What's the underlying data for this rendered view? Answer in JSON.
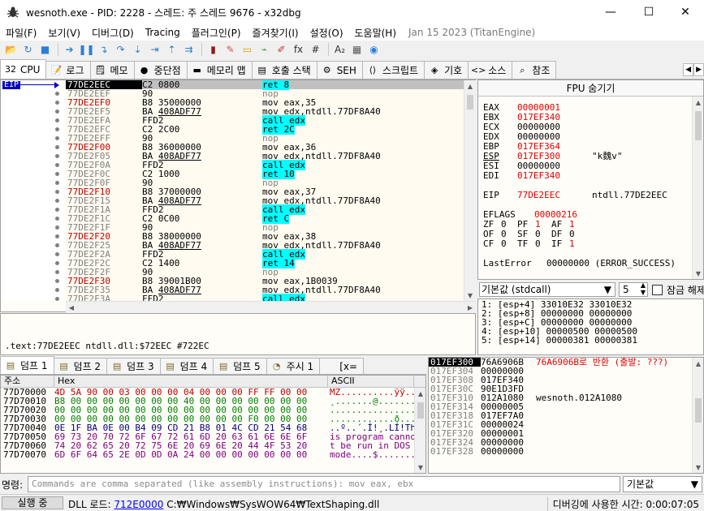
{
  "window": {
    "title": "wesnoth.exe - PID: 2228 - 스레드: 주 스레드 9676 - x32dbg",
    "minimize": "—",
    "maximize": "☐",
    "close": "✕"
  },
  "menu": {
    "items": [
      "파일(F)",
      "보기(V)",
      "디버그(D)",
      "Tracing",
      "플러그인(P)",
      "즐겨찾기(I)",
      "설정(O)",
      "도움말(H)"
    ],
    "build": "Jan 15 2023 (TitanEngine)"
  },
  "toolbar": {
    "buttons": [
      {
        "name": "open-icon",
        "glyph": "📂",
        "color": "#d4a017"
      },
      {
        "name": "restart-icon",
        "glyph": "↻",
        "color": "#2a7fd4"
      },
      {
        "name": "close-debug-icon",
        "glyph": "■",
        "color": "#2a7fd4"
      },
      {
        "name": "run-icon",
        "glyph": "➔",
        "color": "#2a7fd4"
      },
      {
        "name": "pause-icon",
        "glyph": "❚❚",
        "color": "#2a7fd4"
      },
      {
        "name": "step-into-icon",
        "glyph": "↴",
        "color": "#2a7fd4"
      },
      {
        "name": "step-over-icon",
        "glyph": "↷",
        "color": "#2a7fd4"
      },
      {
        "name": "trace-into-icon",
        "glyph": "⇣",
        "color": "#2a7fd4"
      },
      {
        "name": "trace-over-icon",
        "glyph": "⇥",
        "color": "#2a7fd4"
      },
      {
        "name": "execute-till-return-icon",
        "glyph": "⇡",
        "color": "#2a7fd4"
      },
      {
        "name": "run-to-user-code-icon",
        "glyph": "⇉",
        "color": "#2a7fd4"
      },
      {
        "name": "scylla-icon",
        "glyph": "▮",
        "color": "#8b1a1a"
      },
      {
        "name": "patch-icon",
        "glyph": "✎",
        "color": "#d9534f"
      },
      {
        "name": "comment-icon",
        "glyph": "▭",
        "color": "#d9a400"
      },
      {
        "name": "label-icon",
        "glyph": "⌁",
        "color": "#5a8f5a"
      },
      {
        "name": "bookmark-icon",
        "glyph": "✐",
        "color": "#c9302c"
      },
      {
        "name": "function-icon",
        "glyph": "fx",
        "color": "#333333"
      },
      {
        "name": "hash-icon",
        "glyph": "#",
        "color": "#333333"
      },
      {
        "name": "font-icon",
        "glyph": "A₂",
        "color": "#333333"
      },
      {
        "name": "memory-icon",
        "glyph": "▦",
        "color": "#5a5a5a"
      },
      {
        "name": "globe-icon",
        "glyph": "◉",
        "color": "#2a7fd4"
      }
    ]
  },
  "tabs": [
    {
      "name": "tab-cpu",
      "icon": "cpu-icon",
      "glyph": "32",
      "label": "CPU",
      "active": true
    },
    {
      "name": "tab-log",
      "icon": "log-icon",
      "glyph": "📝",
      "label": "로그"
    },
    {
      "name": "tab-notes",
      "icon": "notes-icon",
      "glyph": "🗒",
      "label": "메모"
    },
    {
      "name": "tab-breakpoints",
      "icon": "breakpoint-icon",
      "glyph": "●",
      "label": "중단점"
    },
    {
      "name": "tab-memory-map",
      "icon": "memory-map-icon",
      "glyph": "▬",
      "label": "메모리 맵"
    },
    {
      "name": "tab-call-stack",
      "icon": "call-stack-icon",
      "glyph": "▤",
      "label": "호출 스택"
    },
    {
      "name": "tab-seh",
      "icon": "seh-icon",
      "glyph": "⚙",
      "label": "SEH"
    },
    {
      "name": "tab-script",
      "icon": "script-icon",
      "glyph": "⟨⟩",
      "label": "스크립트"
    },
    {
      "name": "tab-symbols",
      "icon": "symbols-icon",
      "glyph": "◈",
      "label": "기호"
    },
    {
      "name": "tab-source",
      "icon": "source-icon",
      "glyph": "<>",
      "label": "소스"
    },
    {
      "name": "tab-references",
      "icon": "references-icon",
      "glyph": "⌕",
      "label": "참조"
    }
  ],
  "tabs_scroll": {
    "left": "◀",
    "right": "▶"
  },
  "disasm": {
    "eip_label": "EIP",
    "rows": [
      {
        "addr": "77DE2EEC",
        "bytes": "C2 0800",
        "instr": "ret 8",
        "kind": "ret",
        "red": false,
        "cur": true
      },
      {
        "addr": "77DE2EEF",
        "bytes": "90",
        "instr": "nop",
        "kind": "nop",
        "red": false
      },
      {
        "addr": "77DE2EF0",
        "bytes": "B8 35000000",
        "instr": "mov eax,35",
        "kind": "",
        "red": true
      },
      {
        "addr": "77DE2EF5",
        "bytes": "BA 408ADF77",
        "instr": "mov edx,ntdll.77DF8A40",
        "kind": "",
        "red": false,
        "ul": true
      },
      {
        "addr": "77DE2EFA",
        "bytes": "FFD2",
        "instr": "call edx",
        "kind": "call",
        "red": false
      },
      {
        "addr": "77DE2EFC",
        "bytes": "C2 2C00",
        "instr": "ret 2C",
        "kind": "ret",
        "red": false
      },
      {
        "addr": "77DE2EFF",
        "bytes": "90",
        "instr": "nop",
        "kind": "nop",
        "red": false
      },
      {
        "addr": "77DE2F00",
        "bytes": "B8 36000000",
        "instr": "mov eax,36",
        "kind": "",
        "red": true
      },
      {
        "addr": "77DE2F05",
        "bytes": "BA 408ADF77",
        "instr": "mov edx,ntdll.77DF8A40",
        "kind": "",
        "red": false,
        "ul": true
      },
      {
        "addr": "77DE2F0A",
        "bytes": "FFD2",
        "instr": "call edx",
        "kind": "call",
        "red": false
      },
      {
        "addr": "77DE2F0C",
        "bytes": "C2 1000",
        "instr": "ret 10",
        "kind": "ret",
        "red": false
      },
      {
        "addr": "77DE2F0F",
        "bytes": "90",
        "instr": "nop",
        "kind": "nop",
        "red": false
      },
      {
        "addr": "77DE2F10",
        "bytes": "B8 37000000",
        "instr": "mov eax,37",
        "kind": "",
        "red": true
      },
      {
        "addr": "77DE2F15",
        "bytes": "BA 408ADF77",
        "instr": "mov edx,ntdll.77DF8A40",
        "kind": "",
        "red": false,
        "ul": true
      },
      {
        "addr": "77DE2F1A",
        "bytes": "FFD2",
        "instr": "call edx",
        "kind": "call",
        "red": false
      },
      {
        "addr": "77DE2F1C",
        "bytes": "C2 0C00",
        "instr": "ret C",
        "kind": "ret",
        "red": false
      },
      {
        "addr": "77DE2F1F",
        "bytes": "90",
        "instr": "nop",
        "kind": "nop",
        "red": false
      },
      {
        "addr": "77DE2F20",
        "bytes": "B8 38000000",
        "instr": "mov eax,38",
        "kind": "",
        "red": true
      },
      {
        "addr": "77DE2F25",
        "bytes": "BA 408ADF77",
        "instr": "mov edx,ntdll.77DF8A40",
        "kind": "",
        "red": false,
        "ul": true
      },
      {
        "addr": "77DE2F2A",
        "bytes": "FFD2",
        "instr": "call edx",
        "kind": "call",
        "red": false
      },
      {
        "addr": "77DE2F2C",
        "bytes": "C2 1400",
        "instr": "ret 14",
        "kind": "ret",
        "red": false
      },
      {
        "addr": "77DE2F2F",
        "bytes": "90",
        "instr": "nop",
        "kind": "nop",
        "red": false
      },
      {
        "addr": "77DE2F30",
        "bytes": "B8 39001B00",
        "instr": "mov eax,1B0039",
        "kind": "",
        "red": true
      },
      {
        "addr": "77DE2F35",
        "bytes": "BA 408ADF77",
        "instr": "mov edx,ntdll.77DF8A40",
        "kind": "",
        "red": false,
        "ul": true
      },
      {
        "addr": "77DE2F3A",
        "bytes": "FFD2",
        "instr": "call edx",
        "kind": "call",
        "red": false
      }
    ]
  },
  "info": {
    "text": ".text:77DE2EEC ntdll.dll:$72EEC #722EC"
  },
  "registers": {
    "header": "FPU 숨기기",
    "rows": [
      {
        "name": "EAX",
        "value": "00000001",
        "red": true,
        "comment": ""
      },
      {
        "name": "EBX",
        "value": "017EF340",
        "red": true,
        "comment": ""
      },
      {
        "name": "ECX",
        "value": "00000000",
        "red": false,
        "comment": ""
      },
      {
        "name": "EDX",
        "value": "00000000",
        "red": false,
        "comment": ""
      },
      {
        "name": "EBP",
        "value": "017EF364",
        "red": true,
        "comment": ""
      },
      {
        "name": "ESP",
        "value": "017EF300",
        "red": true,
        "comment": "\"k魏v\"",
        "ul": true
      },
      {
        "name": "ESI",
        "value": "00000000",
        "red": false,
        "comment": ""
      },
      {
        "name": "EDI",
        "value": "017EF340",
        "red": true,
        "comment": ""
      }
    ],
    "eip": {
      "name": "EIP",
      "value": "77DE2EEC",
      "comment": "ntdll.77DE2EEC"
    },
    "eflags": {
      "name": "EFLAGS",
      "value": "00000216"
    },
    "flags": [
      [
        {
          "n": "ZF",
          "v": "0",
          "red": false
        },
        {
          "n": "PF",
          "v": "1",
          "red": true
        },
        {
          "n": "AF",
          "v": "1",
          "red": true
        }
      ],
      [
        {
          "n": "OF",
          "v": "0",
          "red": false
        },
        {
          "n": "SF",
          "v": "0",
          "red": false
        },
        {
          "n": "DF",
          "v": "0",
          "red": false
        }
      ],
      [
        {
          "n": "CF",
          "v": "0",
          "red": false
        },
        {
          "n": "TF",
          "v": "0",
          "red": false
        },
        {
          "n": "IF",
          "v": "1",
          "red": true
        }
      ]
    ],
    "lasterror": {
      "name": "LastError",
      "value": "00000000 (ERROR_SUCCESS)"
    }
  },
  "args": {
    "convention": "기본값 (stdcall)",
    "count": "5",
    "checkbox_label": "잠금 해제",
    "rows": [
      "1: [esp+4]  33010E32 33010E32",
      "2: [esp+8]  00000000 00000000",
      "3: [esp+C]  00000000 00000000",
      "4: [esp+10] 00000500 00000500",
      "5: [esp+14] 00000381 00000381"
    ]
  },
  "dump_tabs": [
    {
      "name": "tab-dump-1",
      "label": "덤프 1",
      "active": true
    },
    {
      "name": "tab-dump-2",
      "label": "덤프 2"
    },
    {
      "name": "tab-dump-3",
      "label": "덤프 3"
    },
    {
      "name": "tab-dump-4",
      "label": "덤프 4"
    },
    {
      "name": "tab-dump-5",
      "label": "덤프 5"
    },
    {
      "name": "tab-watch-1",
      "label": "주시 1"
    },
    {
      "name": "tab-locals",
      "label": "[x="
    }
  ],
  "dump": {
    "col_addr": "주소",
    "col_hex": "Hex",
    "col_ascii": "ASCII",
    "rows": [
      {
        "addr": "77D70000",
        "hex": "4D 5A 90 00 03 00 00 00 04 00 00 00 FF FF 00 00",
        "ascii": "MZ..........ÿÿ..",
        "c": "r"
      },
      {
        "addr": "77D70010",
        "hex": "B8 00 00 00 00 00 00 00 40 00 00 00 00 00 00 00",
        "ascii": "¸.......@.......",
        "c": "g"
      },
      {
        "addr": "77D70020",
        "hex": "00 00 00 00 00 00 00 00 00 00 00 00 00 00 00 00",
        "ascii": "................",
        "c": "g"
      },
      {
        "addr": "77D70030",
        "hex": "00 00 00 00 00 00 00 00 00 00 00 00 F0 00 00 00",
        "ascii": "............ð...",
        "c": "g"
      },
      {
        "addr": "77D70040",
        "hex": "0E 1F BA 0E 00 B4 09 CD 21 B8 01 4C CD 21 54 68",
        "ascii": "..º..´.Í!¸.LÍ!Th",
        "c": "b"
      },
      {
        "addr": "77D70050",
        "hex": "69 73 20 70 72 6F 67 72 61 6D 20 63 61 6E 6E 6F",
        "ascii": "is program canno",
        "c": "p"
      },
      {
        "addr": "77D70060",
        "hex": "74 20 62 65 20 72 75 6E 20 69 6E 20 44 4F 53 20",
        "ascii": "t be run in DOS ",
        "c": "p"
      },
      {
        "addr": "77D70070",
        "hex": "6D 6F 64 65 2E 0D 0D 0A 24 00 00 00 00 00 00 00",
        "ascii": "mode....$.......",
        "c": "p"
      }
    ]
  },
  "stack": {
    "rows": [
      {
        "addr": "017EF300",
        "val": "76A6906B",
        "comment": "76A6906B로 반환 (출발: ???)",
        "cur": true
      },
      {
        "addr": "017EF304",
        "val": "00000000",
        "comment": ""
      },
      {
        "addr": "017EF308",
        "val": "017EF340",
        "comment": ""
      },
      {
        "addr": "017EF30C",
        "val": "90E1D3FD",
        "comment": ""
      },
      {
        "addr": "017EF310",
        "val": "012A1080",
        "comment": "wesnoth.012A1080"
      },
      {
        "addr": "017EF314",
        "val": "00000005",
        "comment": ""
      },
      {
        "addr": "017EF318",
        "val": "017EF7A0",
        "comment": ""
      },
      {
        "addr": "017EF31C",
        "val": "00000024",
        "comment": ""
      },
      {
        "addr": "017EF320",
        "val": "00000001",
        "comment": ""
      },
      {
        "addr": "017EF324",
        "val": "00000000",
        "comment": ""
      },
      {
        "addr": "017EF328",
        "val": "00000000",
        "comment": ""
      }
    ]
  },
  "command": {
    "label": "명령:",
    "placeholder": "Commands are comma separated (like assembly instructions): mov eax, ebx",
    "mode": "기본값"
  },
  "status": {
    "state": "실행 중",
    "msg_prefix": "DLL 로드: ",
    "msg_link": "712E0000",
    "msg_suffix": " C:₩Windows₩SysWOW64₩TextShaping.dll",
    "time": "디버깅에 사용한 시간: 0:00:07:05"
  },
  "colors": {
    "accent": "#0000c0",
    "highlight": "#00ffff",
    "red": "#e00000"
  }
}
